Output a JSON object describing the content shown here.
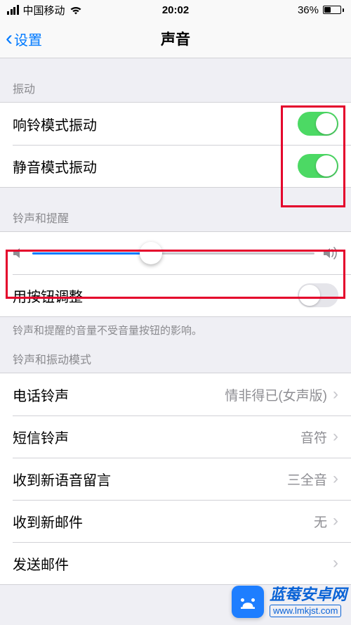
{
  "status": {
    "carrier": "中国移动",
    "time": "20:02",
    "battery_pct": "36%"
  },
  "nav": {
    "back_label": "设置",
    "title": "声音"
  },
  "section_vibration": {
    "header": "振动",
    "ring_vibrate_label": "响铃模式振动",
    "ring_vibrate_on": true,
    "silent_vibrate_label": "静音模式振动",
    "silent_vibrate_on": true
  },
  "section_ringer": {
    "header": "铃声和提醒",
    "volume_pct": 42,
    "change_with_buttons_label": "用按钮调整",
    "change_with_buttons_on": false,
    "footer": "铃声和提醒的音量不受音量按钮的影响。"
  },
  "section_patterns": {
    "header": "铃声和振动模式",
    "items": [
      {
        "label": "电话铃声",
        "value": "情非得已(女声版)"
      },
      {
        "label": "短信铃声",
        "value": "音符"
      },
      {
        "label": "收到新语音留言",
        "value": "三全音"
      },
      {
        "label": "收到新邮件",
        "value": "无"
      },
      {
        "label": "发送邮件",
        "value": ""
      }
    ]
  },
  "watermark": {
    "title": "蓝莓安卓网",
    "url": "www.lmkjst.com"
  }
}
